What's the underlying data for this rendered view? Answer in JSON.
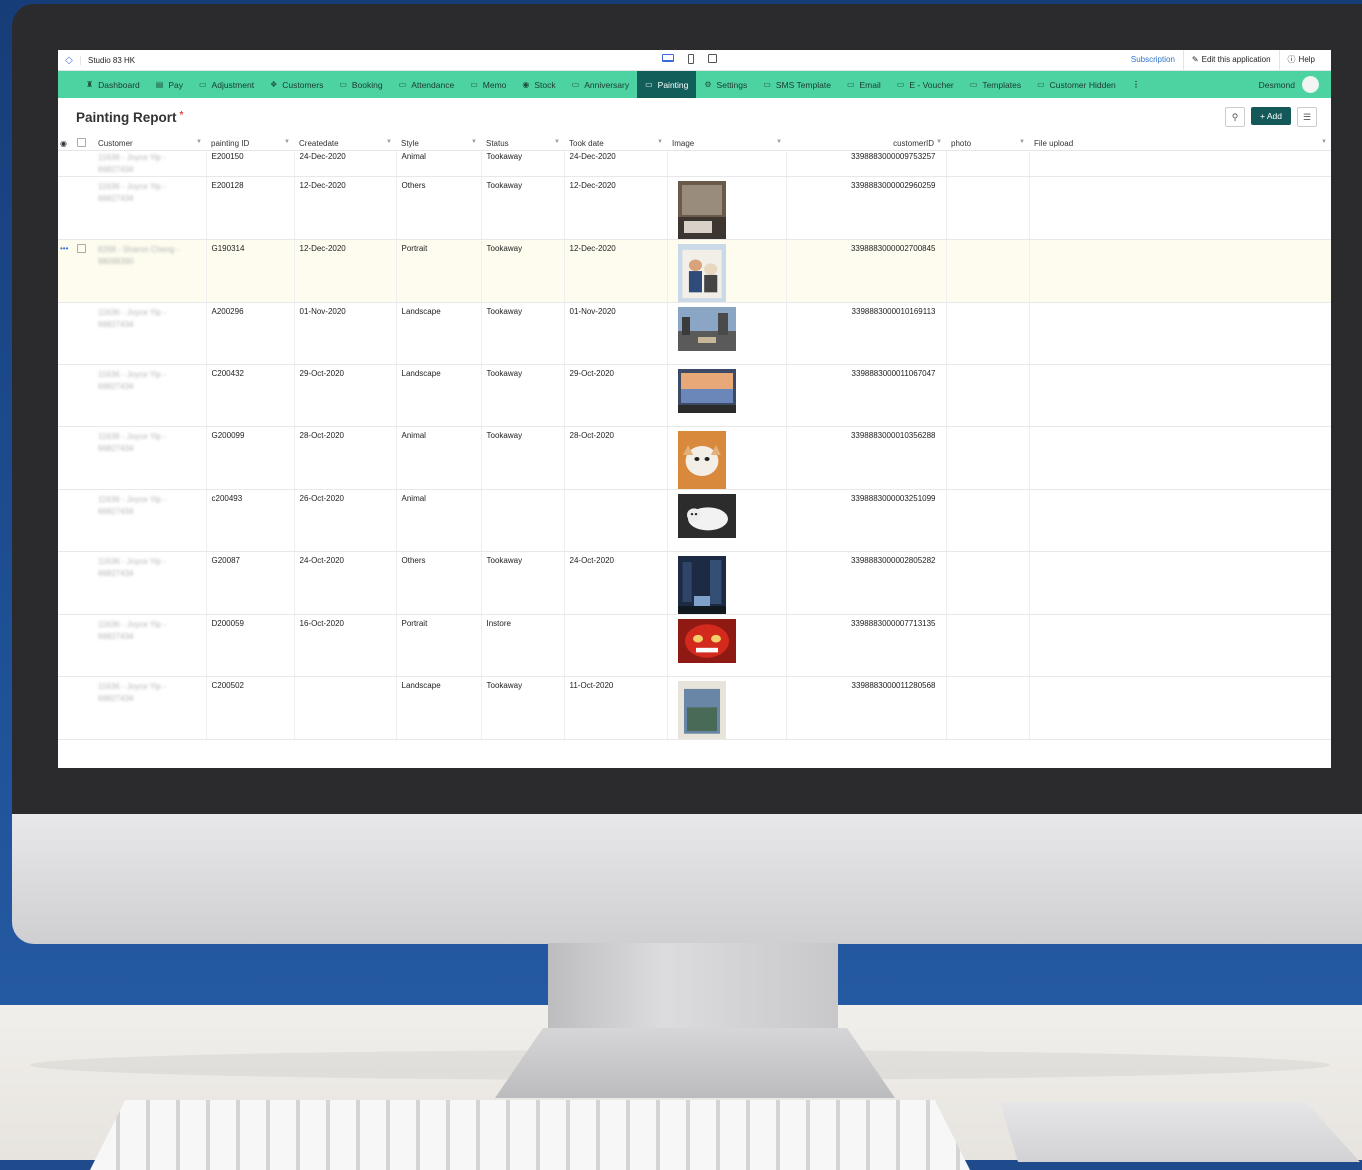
{
  "app": {
    "name": "Studio 83 HK"
  },
  "topbar": {
    "subscription": "Subscription",
    "edit_app": "Edit this application",
    "help": "Help"
  },
  "nav": {
    "items": [
      {
        "label": "Dashboard",
        "icon": "home-icon"
      },
      {
        "label": "Pay",
        "icon": "receipt-icon"
      },
      {
        "label": "Adjustment",
        "icon": "monitor-icon"
      },
      {
        "label": "Customers",
        "icon": "people-icon"
      },
      {
        "label": "Booking",
        "icon": "monitor-icon"
      },
      {
        "label": "Attendance",
        "icon": "monitor-icon"
      },
      {
        "label": "Memo",
        "icon": "monitor-icon"
      },
      {
        "label": "Stock",
        "icon": "database-icon"
      },
      {
        "label": "Anniversary",
        "icon": "monitor-icon"
      },
      {
        "label": "Painting",
        "icon": "monitor-icon",
        "active": true
      },
      {
        "label": "Settings",
        "icon": "gear-icon"
      },
      {
        "label": "SMS Template",
        "icon": "monitor-icon"
      },
      {
        "label": "Email",
        "icon": "monitor-icon"
      },
      {
        "label": "E - Voucher",
        "icon": "monitor-icon"
      },
      {
        "label": "Templates",
        "icon": "monitor-icon"
      },
      {
        "label": "Customer Hidden",
        "icon": "monitor-icon"
      }
    ],
    "user": "Desmond"
  },
  "report": {
    "title": "Painting Report",
    "add_label": "+ Add"
  },
  "table": {
    "columns": [
      "Customer",
      "painting ID",
      "Createdate",
      "Style",
      "Status",
      "Took date",
      "Image",
      "customerID",
      "photo",
      "File upload"
    ],
    "rows": [
      {
        "customer": "11636 - Joyce Yip - 66827434",
        "painting_id": "E200150",
        "createdate": "24-Dec-2020",
        "style": "Animal",
        "status": "Tookaway",
        "took_date": "24-Dec-2020",
        "image": "",
        "customer_id": "3398883000009753257"
      },
      {
        "customer": "11636 - Joyce Yip - 66827434",
        "painting_id": "E200128",
        "createdate": "12-Dec-2020",
        "style": "Others",
        "status": "Tookaway",
        "took_date": "12-Dec-2020",
        "image": "room-painting",
        "customer_id": "3398883000002960259"
      },
      {
        "customer": "8268 - Sharon Cheng - 98098390",
        "painting_id": "G190314",
        "createdate": "12-Dec-2020",
        "style": "Portrait",
        "status": "Tookaway",
        "took_date": "12-Dec-2020",
        "image": "portrait-painting",
        "customer_id": "3398883000002700845",
        "highlight": true
      },
      {
        "customer": "11636 - Joyce Yip - 66827434",
        "painting_id": "A200296",
        "createdate": "01-Nov-2020",
        "style": "Landscape",
        "status": "Tookaway",
        "took_date": "01-Nov-2020",
        "image": "city-painting",
        "customer_id": "3398883000010169113"
      },
      {
        "customer": "11636 - Joyce Yip - 66827434",
        "painting_id": "C200432",
        "createdate": "29-Oct-2020",
        "style": "Landscape",
        "status": "Tookaway",
        "took_date": "29-Oct-2020",
        "image": "sunset-painting",
        "customer_id": "3398883000011067047"
      },
      {
        "customer": "11636 - Joyce Yip - 66827434",
        "painting_id": "G200099",
        "createdate": "28-Oct-2020",
        "style": "Animal",
        "status": "Tookaway",
        "took_date": "28-Oct-2020",
        "image": "dog-painting",
        "customer_id": "3398883000010356288"
      },
      {
        "customer": "11636 - Joyce Yip - 66827434",
        "painting_id": "c200493",
        "createdate": "26-Oct-2020",
        "style": "Animal",
        "status": "",
        "took_date": "",
        "image": "cat-painting",
        "customer_id": "3398883000003251099"
      },
      {
        "customer": "11636 - Joyce Yip - 66827434",
        "painting_id": "G20087",
        "createdate": "24-Oct-2020",
        "style": "Others",
        "status": "Tookaway",
        "took_date": "24-Oct-2020",
        "image": "street-painting",
        "customer_id": "3398883000002805282"
      },
      {
        "customer": "11636 - Joyce Yip - 66827434",
        "painting_id": "D200059",
        "createdate": "16-Oct-2020",
        "style": "Portrait",
        "status": "Instore",
        "took_date": "",
        "image": "mask-painting",
        "customer_id": "3398883000007713135"
      },
      {
        "customer": "11636 - Joyce Yip - 66827434",
        "painting_id": "C200502",
        "createdate": "",
        "style": "Landscape",
        "status": "Tookaway",
        "took_date": "11-Oct-2020",
        "image": "canvas-painting",
        "customer_id": "3398883000011280568"
      }
    ]
  }
}
